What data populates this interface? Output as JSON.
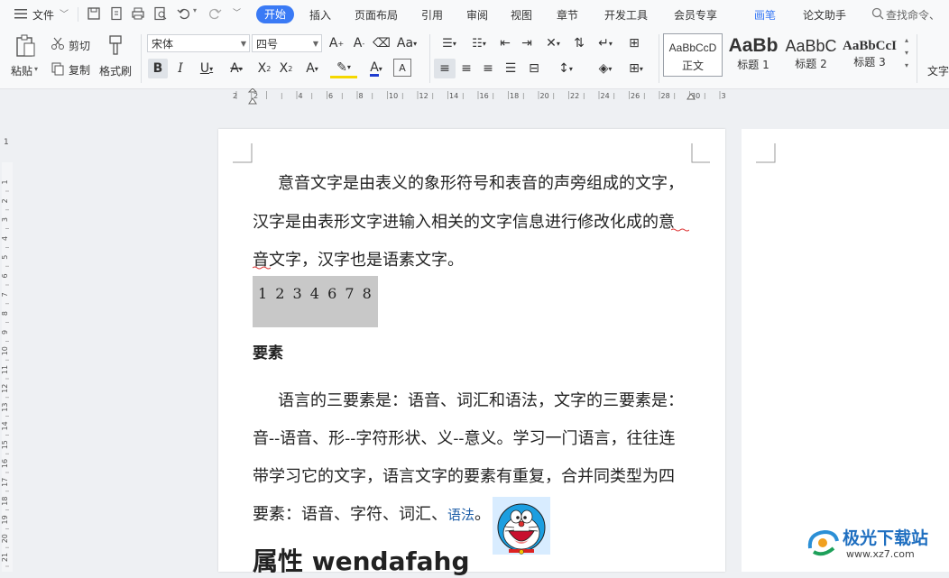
{
  "menu": {
    "file_label": "文件",
    "tabs": [
      "开始",
      "插入",
      "页面布局",
      "引用",
      "审阅",
      "视图",
      "章节",
      "开发工具",
      "会员专享",
      "画笔",
      "论文助手"
    ],
    "search_placeholder": "查找命令、"
  },
  "ribbon": {
    "paste": "粘贴",
    "cut": "剪切",
    "copy": "复制",
    "format_painter": "格式刷",
    "font_name": "宋体",
    "font_size": "四号",
    "styles": [
      {
        "preview": "AaBbCcD",
        "label": "正文"
      },
      {
        "preview": "AaBb",
        "label": "标题 1"
      },
      {
        "preview": "AaBbC",
        "label": "标题 2"
      },
      {
        "preview": "AaBbCcI",
        "label": "标题 3"
      }
    ],
    "text_tools": "文字"
  },
  "ruler": {
    "h_marks": [
      "2",
      "2",
      "4",
      "6",
      "8",
      "10",
      "12",
      "14",
      "16",
      "18",
      "20",
      "22",
      "24",
      "26",
      "28",
      "30",
      "32"
    ],
    "v_marks": [
      "1",
      "1",
      "2",
      "3",
      "4",
      "5",
      "6",
      "7",
      "8",
      "9",
      "10",
      "11",
      "12",
      "13",
      "14",
      "15",
      "16",
      "17",
      "18",
      "19",
      "20",
      "21"
    ]
  },
  "document": {
    "p1_line1": "意音文字是由表义的象形符号和表音的声旁组成的文字，",
    "p1_line2": "汉字是由表形文字进输入相关的文字信息进行修改化成的意",
    "p1_line3": "音文字，汉字也是语素文字。",
    "number_block": "1 2 3 4 6 7 8",
    "heading_elements": "要素",
    "p2_line1": "语言的三要素是：语音、词汇和语法，文字的三要素是：",
    "p2_line2": "音--语音、形--字符形状、义--意义。学习一门语言，往往连",
    "p2_line3": "带学习它的文字，语言文字的要素有重复，合并同类型为四",
    "p2_line4_a": "要素：语音、字符、词汇、",
    "p2_line4_link": "语法",
    "p2_line4_b": "。",
    "heading_attributes": "属性 wendafahg"
  },
  "watermark": {
    "name": "极光下载站",
    "url": "www.xz7.com"
  },
  "colors": {
    "accent": "#3a7af5",
    "link": "#1f5fa8",
    "highlight": "#c8c8c8"
  }
}
